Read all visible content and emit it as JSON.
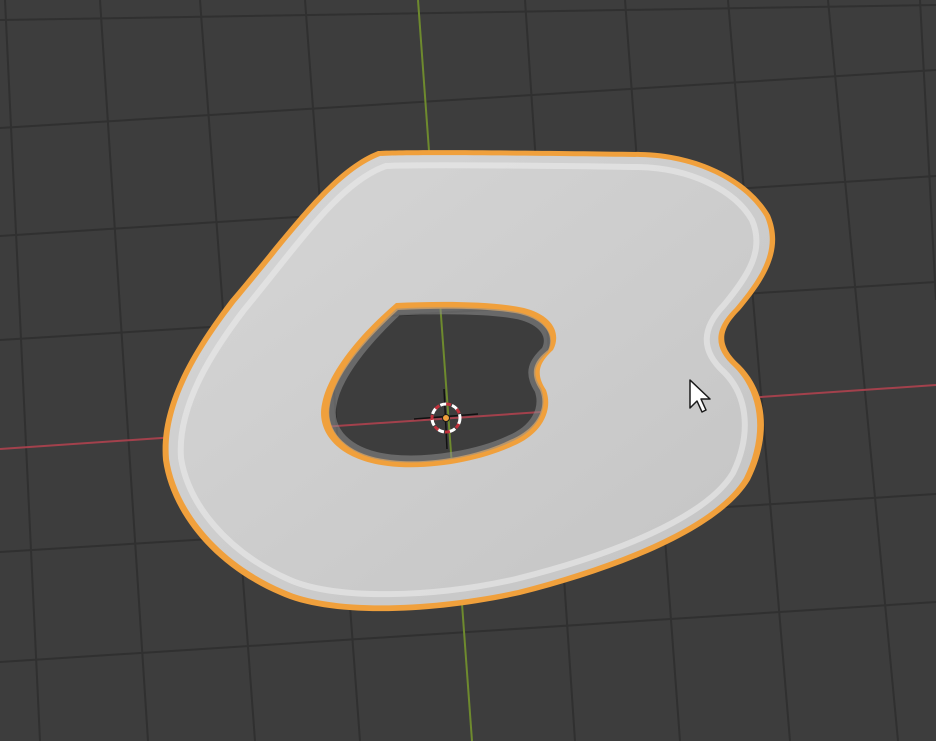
{
  "viewport": {
    "background_color": "#3d3d3d",
    "grid_color": "#2f2f2f",
    "x_axis_color": "#a3414c",
    "y_axis_color": "#6e8a2e",
    "selection_outline_color": "#f0a03c",
    "object_color": "#cfcfcf"
  },
  "scene": {
    "object": {
      "shape": "flat extruded blob with a hole",
      "selected": true
    },
    "origin_marker": {
      "icon": "3d-cursor-icon"
    },
    "mouse_cursor": {
      "icon": "arrow-pointer-icon"
    }
  }
}
